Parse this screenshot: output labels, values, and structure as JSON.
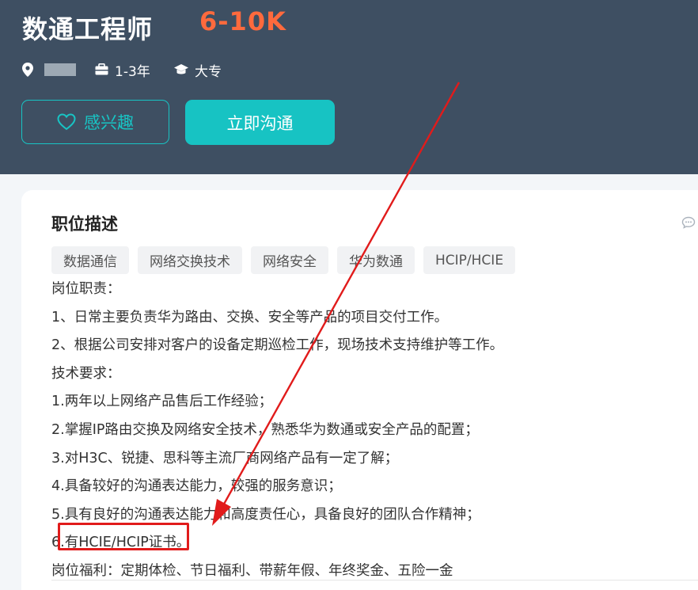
{
  "header": {
    "job_title": "数通工程师",
    "salary": "6-10K",
    "experience": "1-3年",
    "education": "大专",
    "interest_button": "感兴趣",
    "chat_button": "立即沟通"
  },
  "description": {
    "title": "职位描述",
    "tags": [
      "数据通信",
      "网络交换技术",
      "网络安全",
      "华为数通",
      "HCIP/HCIE"
    ],
    "lines": [
      "岗位职责：",
      "1、日常主要负责华为路由、交换、安全等产品的项目交付工作。",
      "2、根据公司安排对客户的设备定期巡检工作，现场技术支持维护等工作。",
      "技术要求：",
      "1.两年以上网络产品售后工作经验；",
      "2.掌握IP路由交换及网络安全技术，熟悉华为数通或安全产品的配置；",
      "3.对H3C、锐捷、思科等主流厂商网络产品有一定了解；",
      "4.具备较好的沟通表达能力，较强的服务意识；",
      "5.具有良好的沟通表达能力和高度责任心，具备良好的团队合作精神；",
      "6.有HCIE/HCIP证书。",
      "岗位福利：定期体检、节日福利、带薪年假、年终奖金、五险一金"
    ]
  },
  "colors": {
    "header_bg": "#3e4f62",
    "salary": "#ff6a3d",
    "accent_teal": "#17c3c3",
    "annotation_red": "#e11b1b"
  },
  "icons": {
    "location": "location-pin-icon",
    "experience": "briefcase-icon",
    "education": "graduation-cap-icon",
    "interest": "heart-outline-icon",
    "chat": "chat-bubble-icon"
  }
}
